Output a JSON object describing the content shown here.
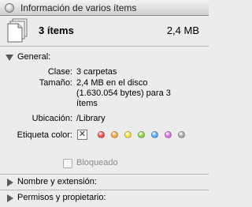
{
  "window": {
    "title": "Información de varios ítems"
  },
  "header": {
    "item_count": "3 ítems",
    "total_size": "2,4 MB"
  },
  "general": {
    "heading": "General:",
    "rows": [
      {
        "label": "Clase:",
        "value": "3 carpetas"
      },
      {
        "label": "Tamaño:",
        "value_lines": [
          "2,4 MB en el disco",
          "(1.630.054 bytes) para 3",
          "ítems"
        ]
      },
      {
        "label": "Ubicación:",
        "value": "/Library"
      },
      {
        "label": "Etiqueta color:",
        "value": ""
      }
    ],
    "label_colors": [
      {
        "name": "red",
        "hex": "#f14b4b"
      },
      {
        "name": "orange",
        "hex": "#f7a43a"
      },
      {
        "name": "yellow",
        "hex": "#f2de3c"
      },
      {
        "name": "green",
        "hex": "#8fd13f"
      },
      {
        "name": "blue",
        "hex": "#4fa3ef"
      },
      {
        "name": "purple",
        "hex": "#d46be0"
      },
      {
        "name": "gray",
        "hex": "#a8a8a8"
      }
    ],
    "none_mark": "✕",
    "locked_label": "Bloqueado"
  },
  "sections": [
    {
      "label": "Nombre y extensión:"
    },
    {
      "label": "Permisos y propietario:"
    }
  ]
}
